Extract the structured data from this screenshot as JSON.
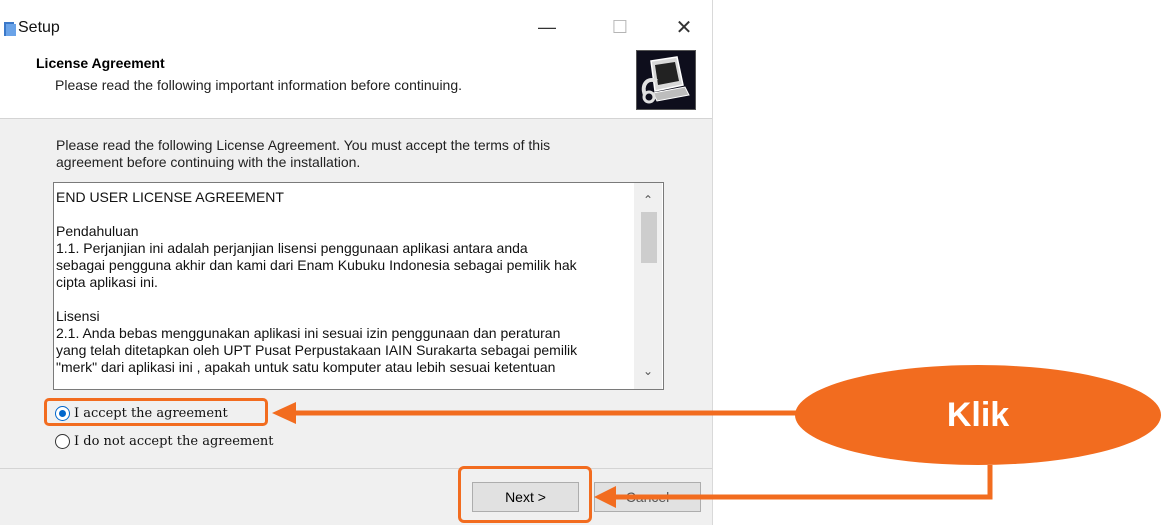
{
  "window": {
    "title": "Setup",
    "minimize_glyph": "—",
    "maximize_glyph": "☐",
    "close_glyph": "✕"
  },
  "header": {
    "title": "License Agreement",
    "subtitle": "Please read the following important information before continuing."
  },
  "intro": {
    "line1": "Please read the following License Agreement. You must accept the terms of this",
    "line2": "agreement before continuing with the installation."
  },
  "license": {
    "heading": "END USER LICENSE AGREEMENT",
    "section1_title": "Pendahuluan",
    "section1_line1": "1.1. Perjanjian ini adalah perjanjian lisensi penggunaan aplikasi antara anda",
    "section1_line2": "sebagai pengguna akhir dan kami dari Enam Kubuku Indonesia sebagai pemilik hak",
    "section1_line3": "cipta aplikasi ini.",
    "section2_title": "Lisensi",
    "section2_line1": "2.1. Anda bebas menggunakan aplikasi ini sesuai izin penggunaan dan peraturan",
    "section2_line2": "yang telah ditetapkan oleh UPT Pusat Perpustakaan IAIN Surakarta sebagai pemilik",
    "section2_line3": "\"merk\" dari aplikasi ini , apakah untuk satu komputer atau lebih sesuai ketentuan",
    "scroll_up_glyph": "⌃",
    "scroll_down_glyph": "⌄"
  },
  "options": {
    "accept_label": "I accept the agreement",
    "accept_selected": true,
    "decline_label": "I do not accept the agreement"
  },
  "buttons": {
    "next_label": "Next >",
    "cancel_label": "Cancel"
  },
  "annotation": {
    "callout_label": "Klik",
    "accent_color": "#f26c1f"
  }
}
